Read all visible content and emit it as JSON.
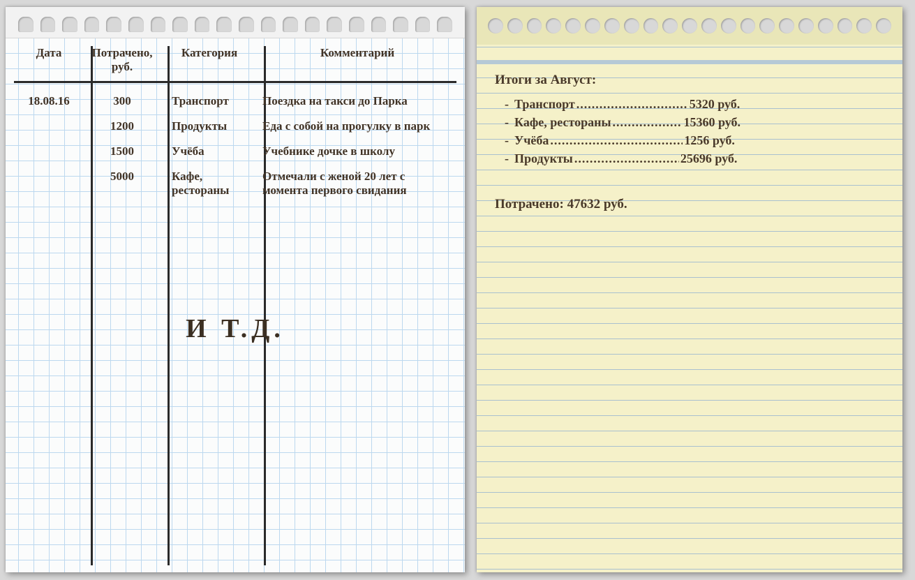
{
  "left": {
    "headers": {
      "date": "Дата",
      "amount": "Потрачено, руб.",
      "category": "Категория",
      "comment": "Комментарий"
    },
    "rows": [
      {
        "date": "18.08.16",
        "amount": "300",
        "category": "Транспорт",
        "comment": "Поездка на такси до Парка"
      },
      {
        "date": "",
        "amount": "1200",
        "category": "Продукты",
        "comment": "Еда с собой на прогулку в парк"
      },
      {
        "date": "",
        "amount": "1500",
        "category": "Учёба",
        "comment": "Учебнике дочке в школу"
      },
      {
        "date": "",
        "amount": "5000",
        "category": "Кафе, рестораны",
        "comment": "Отмечали с женой 20 лет с момента первого свидания"
      }
    ],
    "etc": "И Т.Д."
  },
  "right": {
    "title": "Итоги за Август:",
    "items": [
      {
        "label": "Транспорт",
        "value": "5320 руб."
      },
      {
        "label": "Кафе, рестораны",
        "value": "15360 руб."
      },
      {
        "label": "Учёба",
        "value": "1256 руб."
      },
      {
        "label": "Продукты",
        "value": "25696 руб."
      }
    ],
    "total": "Потрачено: 47632 руб."
  },
  "chart_data": {
    "type": "table",
    "title": "Итоги за Август",
    "categories": [
      "Транспорт",
      "Кафе, рестораны",
      "Учёба",
      "Продукты"
    ],
    "values_rub": [
      5320,
      15360,
      1256,
      25696
    ],
    "total_rub": 47632,
    "currency": "руб.",
    "ledger_date": "18.08.16",
    "ledger_rows": [
      {
        "amount_rub": 300,
        "category": "Транспорт",
        "comment": "Поездка на такси до Парка"
      },
      {
        "amount_rub": 1200,
        "category": "Продукты",
        "comment": "Еда с собой на прогулку в парк"
      },
      {
        "amount_rub": 1500,
        "category": "Учёба",
        "comment": "Учебнике дочке в школу"
      },
      {
        "amount_rub": 5000,
        "category": "Кафе, рестораны",
        "comment": "Отмечали с женой 20 лет с момента первого свидания"
      }
    ]
  }
}
